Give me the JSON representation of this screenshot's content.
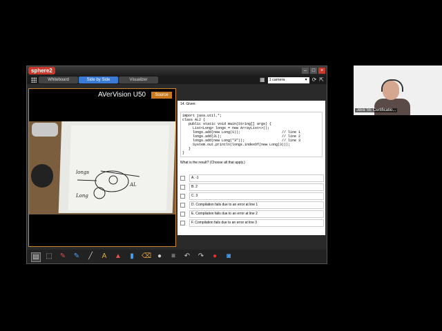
{
  "app": {
    "logo_text": "sphere2",
    "tabs": [
      "Whiteboard",
      "Side by Side",
      "Visualizer"
    ],
    "active_tab": 1,
    "camera_select": "1 camera"
  },
  "left_pane": {
    "title": "AVerVision U50",
    "source_button": "Source",
    "whiteboard_text": [
      "longs",
      "Long",
      "AL"
    ]
  },
  "question": {
    "title": "14. Given:",
    "code": "import java.util.*;\nclass AL2 {\n   public static void main(String[] args) {\n     List<Long> longs = new ArrayList<>();\n     longs.add(new Long(1));                    // line 1\n     longs.add(2L);                             // line 2\n     longs.add(new Long(\"3\"));                  // line 3\n     System.out.println(longs.indexOf(new Long(3)));\n   }\n}",
    "prompt": "What is the result? (Choose all that apply.)",
    "options": [
      "A. -1",
      "B. 2",
      "C. 3",
      "D. Compilation fails due to an error at line 1",
      "E. Compilation fails due to an error at line 2",
      "F. Compilation fails due to an error at line 3"
    ]
  },
  "thumbnail": {
    "label": "Java SE Certificatio..."
  },
  "colors": {
    "accent": "#3a7bd5",
    "border_orange": "#d08a2c",
    "logo_red": "#c8392b"
  }
}
